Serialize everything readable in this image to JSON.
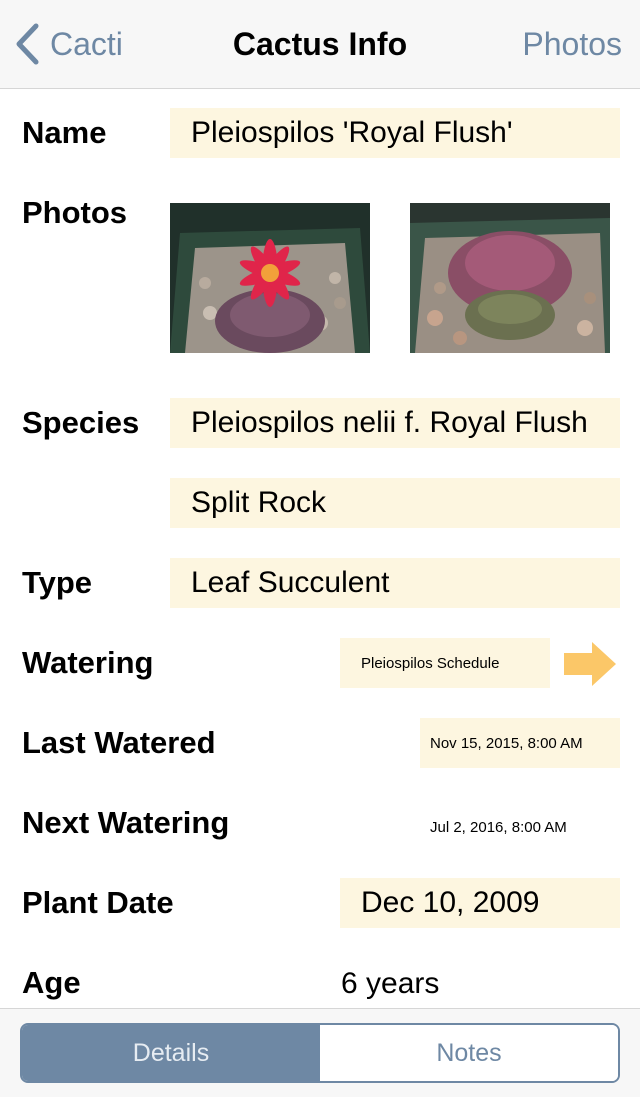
{
  "nav": {
    "back_label": "Cacti",
    "title": "Cactus Info",
    "photos_label": "Photos"
  },
  "details": {
    "name_label": "Name",
    "name_value": "Pleiospilos 'Royal Flush'",
    "photos_label": "Photos",
    "species_label": "Species",
    "species_value": "Pleiospilos nelii f. Royal Flush",
    "common_name_value": "Split Rock",
    "type_label": "Type",
    "type_value": "Leaf Succulent",
    "watering_label": "Watering",
    "watering_value": "Pleiospilos Schedule",
    "last_watered_label": "Last Watered",
    "last_watered_value": "Nov 15, 2015, 8:00 AM",
    "next_watering_label": "Next Watering",
    "next_watering_value": "Jul 2, 2016, 8:00 AM",
    "plant_date_label": "Plant Date",
    "plant_date_value": "Dec 10, 2009",
    "age_label": "Age",
    "age_value": "6 years"
  },
  "tabs": {
    "details_label": "Details",
    "notes_label": "Notes",
    "selected": "Details"
  },
  "colors": {
    "accent": "#6e88a4",
    "field_bg": "#fdf6e0",
    "arrow": "#fbc768",
    "bar_bg": "#f7f7f7"
  },
  "icons": {
    "back": "chevron-left-icon",
    "go": "arrow-right-icon"
  }
}
